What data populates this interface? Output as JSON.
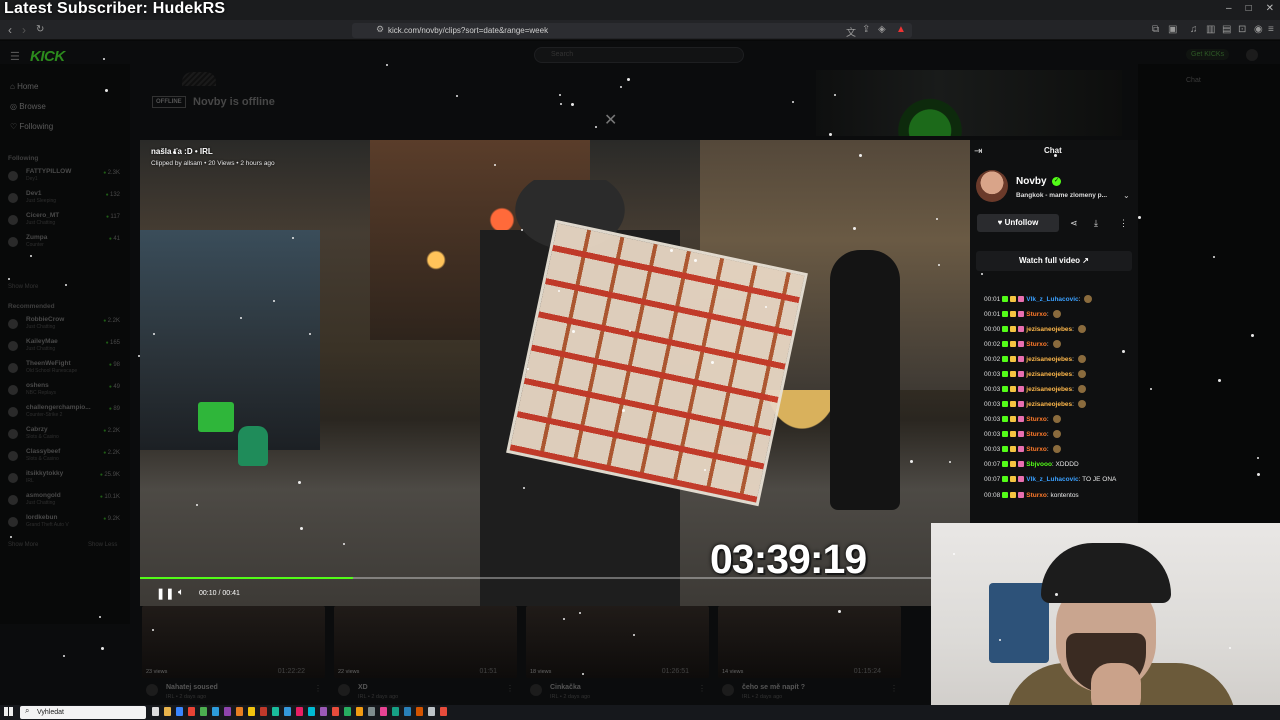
{
  "overlay": {
    "subscriber_text": "Latest Subscriber: HudekRS"
  },
  "browser": {
    "url": "kick.com/novby/clips?sort=date&range=week",
    "window_controls": [
      "–",
      "□",
      "✕"
    ]
  },
  "kick": {
    "logo": "KICK",
    "search_placeholder": "Search",
    "get_kicks": "Get KICKs",
    "nav": [
      {
        "label": "Home",
        "icon": "home-icon"
      },
      {
        "label": "Browse",
        "icon": "browse-icon"
      },
      {
        "label": "Following",
        "icon": "heart-icon"
      }
    ],
    "following_title": "Following",
    "following": [
      {
        "name": "FATTYPILLOW",
        "category": "Dey1",
        "viewers": "2.3K"
      },
      {
        "name": "Dev1",
        "category": "Just Sleeping",
        "viewers": "132"
      },
      {
        "name": "Cicero_MT",
        "category": "Just Chatting",
        "viewers": "117"
      },
      {
        "name": "Zumpa",
        "category": "Counter",
        "viewers": "41"
      }
    ],
    "show_more": "Show More",
    "recommended_title": "Recommended",
    "recommended": [
      {
        "name": "RobbieCrow",
        "category": "Just Chatting",
        "viewers": "2.2K"
      },
      {
        "name": "KaileyMae",
        "category": "Just Chatting",
        "viewers": "165"
      },
      {
        "name": "TheenWeFight",
        "category": "Old School Runescape",
        "viewers": "98"
      },
      {
        "name": "oshens",
        "category": "NBC Replays",
        "viewers": "49"
      },
      {
        "name": "challengerchampio...",
        "category": "Counter-Strike 2",
        "viewers": "89"
      },
      {
        "name": "Cabrzy",
        "category": "Slots & Casino",
        "viewers": "2.2K"
      },
      {
        "name": "Classybeef",
        "category": "Slots & Casino",
        "viewers": "2.2K"
      },
      {
        "name": "itsikkytokky",
        "category": "IRL",
        "viewers": "25.9K"
      },
      {
        "name": "asmongold",
        "category": "Just Chatting",
        "viewers": "10.1K"
      },
      {
        "name": "lordkebun",
        "category": "Grand Theft Auto V",
        "viewers": "9.2K"
      }
    ],
    "show_less": "Show Less",
    "offline_badge": "OFFLINE",
    "offline_title": "Novby is offline"
  },
  "clip": {
    "title": "našla ťa :D • IRL",
    "meta": "Clipped by allsam • 20 Views • 2 hours ago",
    "timer": "03:39:19",
    "time": "00:10 / 00:41",
    "progress": 0.257
  },
  "chat": {
    "title": "Chat",
    "streamer": "Novby",
    "stream_title": "Bangkok - mame zlomeny p...",
    "unfollow": "Unfollow",
    "watch_full": "Watch full video",
    "messages": [
      {
        "time": "00:01",
        "user": "Vlk_z_Luhacovic",
        "color": "#3aa0ff",
        "text": ""
      },
      {
        "time": "00:01",
        "user": "Sturxo",
        "color": "#ff7a2a",
        "text": ""
      },
      {
        "time": "00:00",
        "user": "jezisaneojebes",
        "color": "#ffb84a",
        "text": ""
      },
      {
        "time": "00:02",
        "user": "Sturxo",
        "color": "#ff7a2a",
        "text": ""
      },
      {
        "time": "00:02",
        "user": "jezisaneojebes",
        "color": "#ffb84a",
        "text": ""
      },
      {
        "time": "00:03",
        "user": "jezisaneojebes",
        "color": "#ffb84a",
        "text": ""
      },
      {
        "time": "00:03",
        "user": "jezisaneojebes",
        "color": "#ffb84a",
        "text": ""
      },
      {
        "time": "00:03",
        "user": "jezisaneojebes",
        "color": "#ffb84a",
        "text": ""
      },
      {
        "time": "00:03",
        "user": "Sturxo",
        "color": "#ff7a2a",
        "text": ""
      },
      {
        "time": "00:03",
        "user": "Sturxo",
        "color": "#ff7a2a",
        "text": ""
      },
      {
        "time": "00:03",
        "user": "Sturxo",
        "color": "#ff7a2a",
        "text": ""
      },
      {
        "time": "00:07",
        "user": "Sbjvooo",
        "color": "#53fc18",
        "text": "XDDDD"
      },
      {
        "time": "00:07",
        "user": "Vlk_z_Luhacovic",
        "color": "#3aa0ff",
        "text": "TO JE ONA"
      },
      {
        "time": "00:08",
        "user": "Sturxo",
        "color": "#ff7a2a",
        "text": "kontentos"
      }
    ]
  },
  "right_chat": {
    "title": "Chat"
  },
  "clips": [
    {
      "title": "Nahatej soused",
      "meta": "IRL • 2 days ago",
      "views": "23 views",
      "duration": "01:22:22"
    },
    {
      "title": "XD",
      "meta": "IRL • 2 days ago",
      "views": "22 views",
      "duration": "01:51"
    },
    {
      "title": "Cinkačka",
      "meta": "IRL • 2 days ago",
      "views": "18 views",
      "duration": "01:26:51"
    },
    {
      "title": "čeho se mě napít ?",
      "meta": "IRL • 2 days ago",
      "views": "14 views",
      "duration": "01:15:24"
    }
  ],
  "taskbar": {
    "search": "Vyhledat"
  }
}
